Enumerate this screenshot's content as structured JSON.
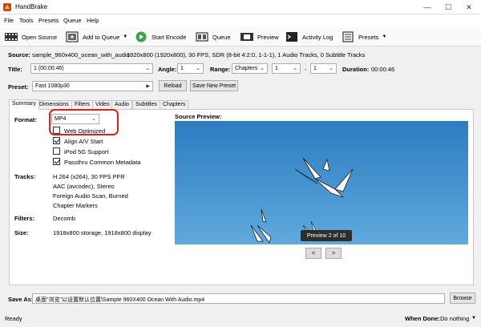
{
  "window": {
    "title": "HandBrake",
    "controls": [
      "—",
      "☐",
      "✕"
    ]
  },
  "menu": [
    "File",
    "Tools",
    "Presets",
    "Queue",
    "Help"
  ],
  "toolbar": {
    "open_source": "Open Source",
    "add_to_queue": "Add to Queue",
    "start_encode": "Start Encode",
    "queue": "Queue",
    "preview": "Preview",
    "activity_log": "Activity Log",
    "presets": "Presets"
  },
  "source": {
    "label": "Source:",
    "name": "sample_960x400_ocean_with_audio",
    "info": "1920x800 (1920x800), 30 FPS, SDR (8-bit 4:2:0, 1-1-1), 1 Audio Tracks, 0 Subtitle Tracks"
  },
  "title_row": {
    "title_label": "Title:",
    "title_value": "1 (00:00:46)",
    "angle_label": "Angle:",
    "angle_value": "1",
    "range_label": "Range:",
    "range_type": "Chapters",
    "range_start": "1",
    "range_sep": "-",
    "range_end": "1",
    "duration_label": "Duration:",
    "duration_value": "00:00:46"
  },
  "preset_row": {
    "label": "Preset:",
    "value": "Fast 1080p30",
    "reload": "Reload",
    "save_new": "Save New Preset"
  },
  "tabs": [
    "Summary",
    "Dimensions",
    "Filters",
    "Video",
    "Audio",
    "Subtitles",
    "Chapters"
  ],
  "summary": {
    "format_label": "Format:",
    "format_value": "MP4",
    "web_optimized": {
      "label": "Web Optimized",
      "checked": false
    },
    "align_av": {
      "label": "Align A/V Start",
      "checked": true
    },
    "ipod": {
      "label": "iPod 5G Support",
      "checked": false
    },
    "passthru": {
      "label": "Passthru Common Metadata",
      "checked": true
    },
    "tracks_label": "Tracks:",
    "tracks": [
      "H.264 (x264), 30 FPS PFR",
      "AAC (avcodec), Stereo",
      "Foreign Audio Scan, Burned",
      "Chapter Markers"
    ],
    "filters_label": "Filters:",
    "filters_value": "Decomb",
    "size_label": "Size:",
    "size_value": "1918x800 storage, 1918x800 display"
  },
  "source_preview": {
    "label": "Source Preview:",
    "badge": "Preview 2 of 10",
    "prev": "<",
    "next": ">"
  },
  "save_as": {
    "label": "Save As:",
    "path": "桌面\"浏览\"以设置默认位置\\Sample 960X400 Ocean With Audio.mp4",
    "browse": "Browse"
  },
  "status": {
    "text": "Ready",
    "when_done_label": "When Done:",
    "when_done_value": "Do nothing"
  },
  "colors": {
    "highlight": "#e0201a",
    "sky": "#4b98d2"
  }
}
